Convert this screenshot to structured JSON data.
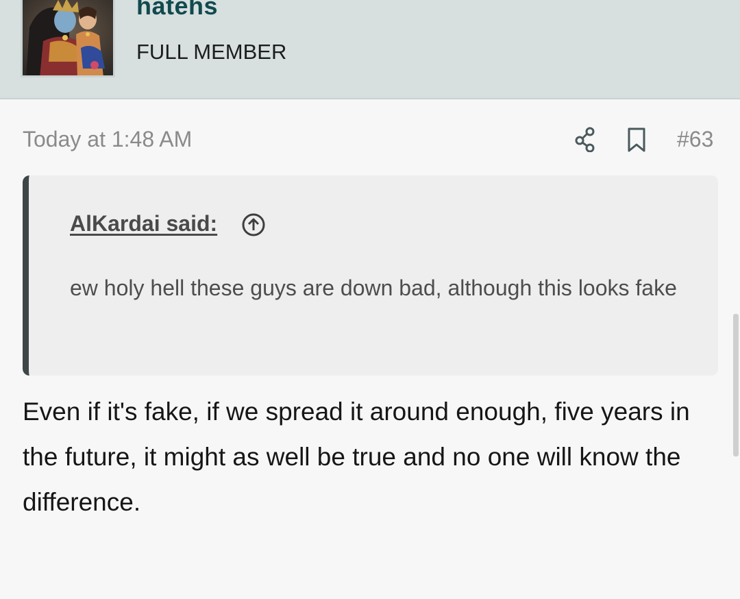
{
  "post": {
    "author": {
      "username": "hatehs",
      "title": "FULL MEMBER",
      "avatar_icon": "avatar-portrait-image"
    },
    "timestamp": "Today at 1:48 AM",
    "actions": {
      "share_icon": "share-icon",
      "bookmark_icon": "bookmark-icon",
      "post_number": "#63"
    },
    "quote": {
      "author_label": "AlKardai said:",
      "jump_icon": "arrow-up-circle-icon",
      "text": "ew holy hell these guys are down bad, although this looks fake"
    },
    "body": "Even if it's fake, if we spread it around enough, five years in the future, it might as well be true and no one will know the difference."
  },
  "colors": {
    "header_bg": "#d7dfdf",
    "username": "#114a4f",
    "quote_bg": "#eeeeee",
    "quote_border": "#3e4648",
    "page_bg": "#f7f7f7"
  }
}
